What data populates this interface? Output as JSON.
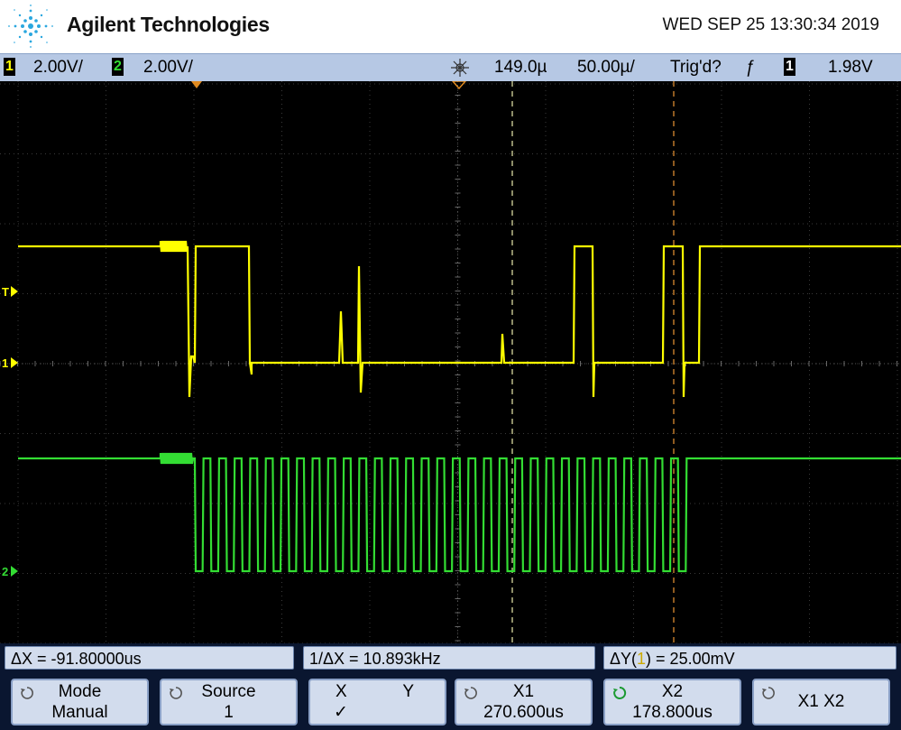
{
  "header": {
    "brand": "Agilent Technologies",
    "datetime": "WED SEP 25 13:30:34 2019"
  },
  "statusbar": {
    "ch1_label": "1",
    "ch1_scale": "2.00V/",
    "ch2_label": "2",
    "ch2_scale": "2.00V/",
    "time_delay": "149.0µ",
    "time_scale": "50.00µ/",
    "trigger_status": "Trig'd?",
    "trigger_source": "1",
    "trigger_level": "1.98V",
    "edge_symbol": "ƒ"
  },
  "screen": {
    "ch1_color": "#ffff00",
    "ch2_color": "#33dd33",
    "marker_T": "T",
    "marker_ch1": "1",
    "marker_ch2": "2"
  },
  "measurements": {
    "delta_x": "ΔX = -91.80000us",
    "inv_delta_x": "1/ΔX = 10.893kHz",
    "delta_y_pre": "ΔY(",
    "delta_y_ch": "1",
    "delta_y_post": ") = 25.00mV"
  },
  "softkeys": {
    "mode_title": "Mode",
    "mode_value": "Manual",
    "source_title": "Source",
    "source_value": "1",
    "x_label": "X",
    "y_label": "Y",
    "check": "✓",
    "x1_title": "X1",
    "x1_value": "270.600us",
    "x2_title": "X2",
    "x2_value": "178.800us",
    "x1x2_label": "X1 X2"
  },
  "colors": {
    "status_bg": "#b6c8e4",
    "softkey_bg": "#d2dced",
    "cursor_x1": "#d9d9a0",
    "cursor_x2": "#d98a30"
  }
}
